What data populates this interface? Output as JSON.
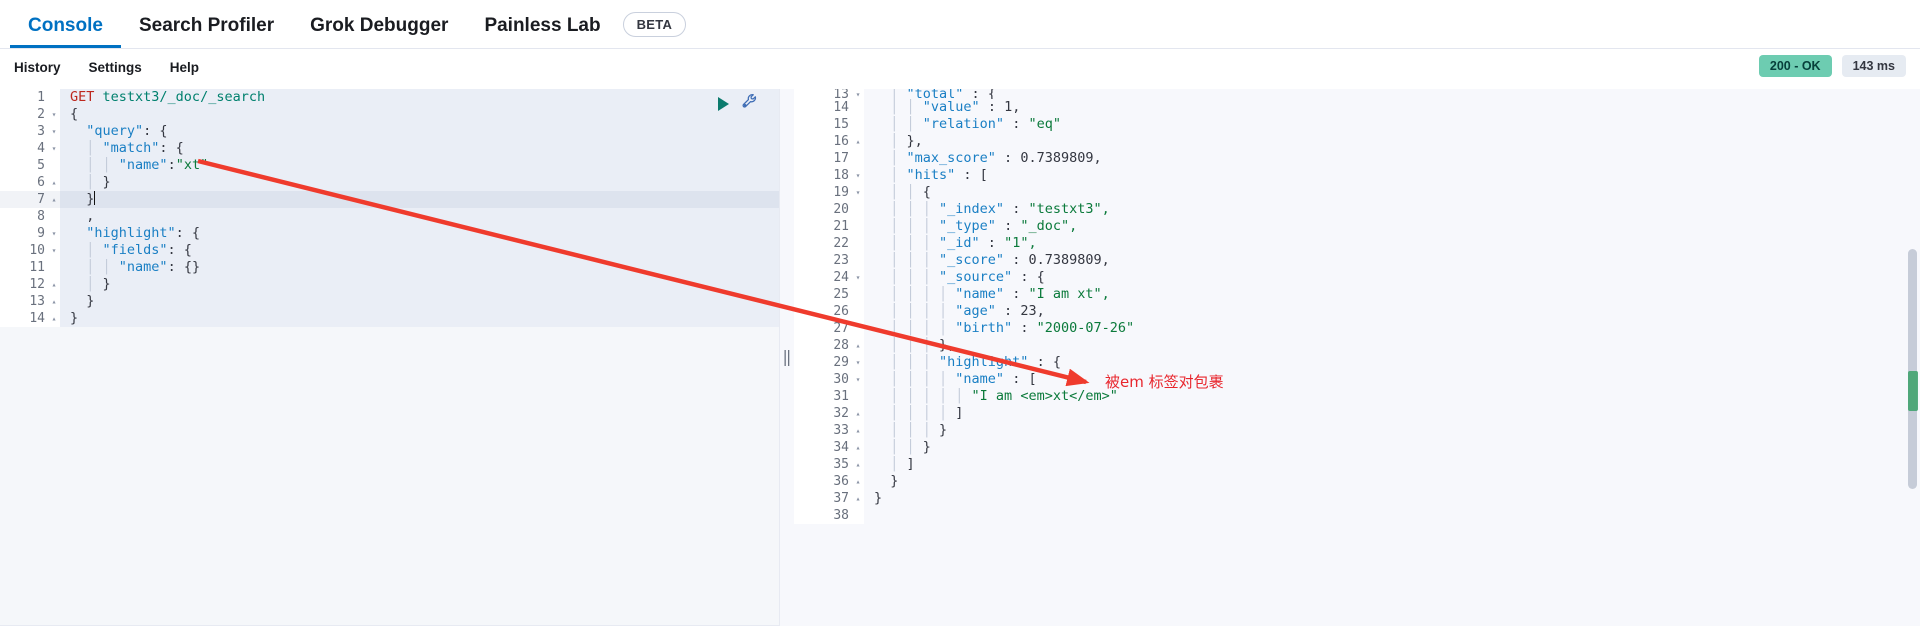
{
  "tabs": [
    {
      "label": "Console",
      "active": true
    },
    {
      "label": "Search Profiler",
      "active": false
    },
    {
      "label": "Grok Debugger",
      "active": false
    },
    {
      "label": "Painless Lab",
      "active": false
    }
  ],
  "beta_badge": "BETA",
  "submenu": [
    "History",
    "Settings",
    "Help"
  ],
  "status": {
    "code": "200 - OK",
    "time": "143 ms"
  },
  "request_editor": {
    "lines": [
      {
        "n": "1",
        "fold": "",
        "segments": [
          {
            "t": "method",
            "v": "GET"
          },
          {
            "t": "plain",
            "v": " "
          },
          {
            "t": "url",
            "v": "testxt3/_doc/_search"
          }
        ]
      },
      {
        "n": "2",
        "fold": "▾",
        "segments": [
          {
            "t": "punc",
            "v": "{"
          }
        ]
      },
      {
        "n": "3",
        "fold": "▾",
        "segments": [
          {
            "t": "plain",
            "v": "  "
          },
          {
            "t": "key",
            "v": "\"query\""
          },
          {
            "t": "punc",
            "v": ": {"
          }
        ]
      },
      {
        "n": "4",
        "fold": "▾",
        "segments": [
          {
            "t": "guide",
            "v": "  │ "
          },
          {
            "t": "key",
            "v": "\"match\""
          },
          {
            "t": "punc",
            "v": ": {"
          }
        ]
      },
      {
        "n": "5",
        "fold": "",
        "segments": [
          {
            "t": "guide",
            "v": "  │ │ "
          },
          {
            "t": "key",
            "v": "\"name\""
          },
          {
            "t": "punc",
            "v": ":"
          },
          {
            "t": "str",
            "v": "\"xt\""
          }
        ]
      },
      {
        "n": "6",
        "fold": "▴",
        "segments": [
          {
            "t": "guide",
            "v": "  │ "
          },
          {
            "t": "punc",
            "v": "}"
          }
        ]
      },
      {
        "n": "7",
        "fold": "▴",
        "segments": [
          {
            "t": "plain",
            "v": "  "
          },
          {
            "t": "punc",
            "v": "}"
          },
          {
            "t": "caret",
            "v": ""
          }
        ]
      },
      {
        "n": "8",
        "fold": "",
        "segments": [
          {
            "t": "punc",
            "v": "  ,"
          }
        ]
      },
      {
        "n": "9",
        "fold": "▾",
        "segments": [
          {
            "t": "plain",
            "v": "  "
          },
          {
            "t": "key",
            "v": "\"highlight\""
          },
          {
            "t": "punc",
            "v": ": {"
          }
        ]
      },
      {
        "n": "10",
        "fold": "▾",
        "segments": [
          {
            "t": "guide",
            "v": "  │ "
          },
          {
            "t": "key",
            "v": "\"fields\""
          },
          {
            "t": "punc",
            "v": ": {"
          }
        ]
      },
      {
        "n": "11",
        "fold": "",
        "segments": [
          {
            "t": "guide",
            "v": "  │ │ "
          },
          {
            "t": "key",
            "v": "\"name\""
          },
          {
            "t": "punc",
            "v": ": {}"
          }
        ]
      },
      {
        "n": "12",
        "fold": "▴",
        "segments": [
          {
            "t": "guide",
            "v": "  │ "
          },
          {
            "t": "punc",
            "v": "}"
          }
        ]
      },
      {
        "n": "13",
        "fold": "▴",
        "segments": [
          {
            "t": "plain",
            "v": "  "
          },
          {
            "t": "punc",
            "v": "}"
          }
        ]
      },
      {
        "n": "14",
        "fold": "▴",
        "segments": [
          {
            "t": "punc",
            "v": "}"
          }
        ]
      }
    ],
    "active_line": 7
  },
  "response_editor": {
    "lines": [
      {
        "n": "13",
        "fold": "▾",
        "clipped": true,
        "segments": [
          {
            "t": "guide",
            "v": "  │ "
          },
          {
            "t": "key",
            "v": "\"total\""
          },
          {
            "t": "punc",
            "v": " : {"
          }
        ]
      },
      {
        "n": "14",
        "fold": "",
        "segments": [
          {
            "t": "guide",
            "v": "  │ │ "
          },
          {
            "t": "key",
            "v": "\"value\""
          },
          {
            "t": "punc",
            "v": " : "
          },
          {
            "t": "num",
            "v": "1,"
          }
        ]
      },
      {
        "n": "15",
        "fold": "",
        "segments": [
          {
            "t": "guide",
            "v": "  │ │ "
          },
          {
            "t": "key",
            "v": "\"relation\""
          },
          {
            "t": "punc",
            "v": " : "
          },
          {
            "t": "str",
            "v": "\"eq\""
          }
        ]
      },
      {
        "n": "16",
        "fold": "▴",
        "segments": [
          {
            "t": "guide",
            "v": "  │ "
          },
          {
            "t": "punc",
            "v": "},"
          }
        ]
      },
      {
        "n": "17",
        "fold": "",
        "segments": [
          {
            "t": "guide",
            "v": "  │ "
          },
          {
            "t": "key",
            "v": "\"max_score\""
          },
          {
            "t": "punc",
            "v": " : "
          },
          {
            "t": "num",
            "v": "0.7389809,"
          }
        ]
      },
      {
        "n": "18",
        "fold": "▾",
        "segments": [
          {
            "t": "guide",
            "v": "  │ "
          },
          {
            "t": "key",
            "v": "\"hits\""
          },
          {
            "t": "punc",
            "v": " : ["
          }
        ]
      },
      {
        "n": "19",
        "fold": "▾",
        "segments": [
          {
            "t": "guide",
            "v": "  │ │ "
          },
          {
            "t": "punc",
            "v": "{"
          }
        ]
      },
      {
        "n": "20",
        "fold": "",
        "segments": [
          {
            "t": "guide",
            "v": "  │ │ │ "
          },
          {
            "t": "key",
            "v": "\"_index\""
          },
          {
            "t": "punc",
            "v": " : "
          },
          {
            "t": "str",
            "v": "\"testxt3\","
          }
        ]
      },
      {
        "n": "21",
        "fold": "",
        "segments": [
          {
            "t": "guide",
            "v": "  │ │ │ "
          },
          {
            "t": "key",
            "v": "\"_type\""
          },
          {
            "t": "punc",
            "v": " : "
          },
          {
            "t": "str",
            "v": "\"_doc\","
          }
        ]
      },
      {
        "n": "22",
        "fold": "",
        "segments": [
          {
            "t": "guide",
            "v": "  │ │ │ "
          },
          {
            "t": "key",
            "v": "\"_id\""
          },
          {
            "t": "punc",
            "v": " : "
          },
          {
            "t": "str",
            "v": "\"1\","
          }
        ]
      },
      {
        "n": "23",
        "fold": "",
        "segments": [
          {
            "t": "guide",
            "v": "  │ │ │ "
          },
          {
            "t": "key",
            "v": "\"_score\""
          },
          {
            "t": "punc",
            "v": " : "
          },
          {
            "t": "num",
            "v": "0.7389809,"
          }
        ]
      },
      {
        "n": "24",
        "fold": "▾",
        "segments": [
          {
            "t": "guide",
            "v": "  │ │ │ "
          },
          {
            "t": "key",
            "v": "\"_source\""
          },
          {
            "t": "punc",
            "v": " : {"
          }
        ]
      },
      {
        "n": "25",
        "fold": "",
        "segments": [
          {
            "t": "guide",
            "v": "  │ │ │ │ "
          },
          {
            "t": "key",
            "v": "\"name\""
          },
          {
            "t": "punc",
            "v": " : "
          },
          {
            "t": "str",
            "v": "\"I am xt\","
          }
        ]
      },
      {
        "n": "26",
        "fold": "",
        "segments": [
          {
            "t": "guide",
            "v": "  │ │ │ │ "
          },
          {
            "t": "key",
            "v": "\"age\""
          },
          {
            "t": "punc",
            "v": " : "
          },
          {
            "t": "num",
            "v": "23,"
          }
        ]
      },
      {
        "n": "27",
        "fold": "",
        "segments": [
          {
            "t": "guide",
            "v": "  │ │ │ │ "
          },
          {
            "t": "key",
            "v": "\"birth\""
          },
          {
            "t": "punc",
            "v": " : "
          },
          {
            "t": "str",
            "v": "\"2000-07-26\""
          }
        ]
      },
      {
        "n": "28",
        "fold": "▴",
        "segments": [
          {
            "t": "guide",
            "v": "  │ │ │ "
          },
          {
            "t": "punc",
            "v": "},"
          }
        ]
      },
      {
        "n": "29",
        "fold": "▾",
        "segments": [
          {
            "t": "guide",
            "v": "  │ │ │ "
          },
          {
            "t": "key",
            "v": "\"highlight\""
          },
          {
            "t": "punc",
            "v": " : {"
          }
        ]
      },
      {
        "n": "30",
        "fold": "▾",
        "segments": [
          {
            "t": "guide",
            "v": "  │ │ │ │ "
          },
          {
            "t": "key",
            "v": "\"name\""
          },
          {
            "t": "punc",
            "v": " : ["
          }
        ]
      },
      {
        "n": "31",
        "fold": "",
        "segments": [
          {
            "t": "guide",
            "v": "  │ │ │ │ │ "
          },
          {
            "t": "str",
            "v": "\"I am <em>xt</em>\""
          }
        ]
      },
      {
        "n": "32",
        "fold": "▴",
        "segments": [
          {
            "t": "guide",
            "v": "  │ │ │ │ "
          },
          {
            "t": "punc",
            "v": "]"
          }
        ]
      },
      {
        "n": "33",
        "fold": "▴",
        "segments": [
          {
            "t": "guide",
            "v": "  │ │ │ "
          },
          {
            "t": "punc",
            "v": "}"
          }
        ]
      },
      {
        "n": "34",
        "fold": "▴",
        "segments": [
          {
            "t": "guide",
            "v": "  │ │ "
          },
          {
            "t": "punc",
            "v": "}"
          }
        ]
      },
      {
        "n": "35",
        "fold": "▴",
        "segments": [
          {
            "t": "guide",
            "v": "  │ "
          },
          {
            "t": "punc",
            "v": "]"
          }
        ]
      },
      {
        "n": "36",
        "fold": "▴",
        "segments": [
          {
            "t": "guide",
            "v": "  "
          },
          {
            "t": "punc",
            "v": "}"
          }
        ]
      },
      {
        "n": "37",
        "fold": "▴",
        "segments": [
          {
            "t": "punc",
            "v": "}"
          }
        ]
      },
      {
        "n": "38",
        "fold": "",
        "segments": []
      }
    ]
  },
  "annotation": {
    "text": "被em 标签对包裹",
    "color": "#e8262d"
  },
  "icons": {
    "play": "play-triangle-icon",
    "wrench": "wrench-icon",
    "splitter": "splitter-handle-icon"
  }
}
